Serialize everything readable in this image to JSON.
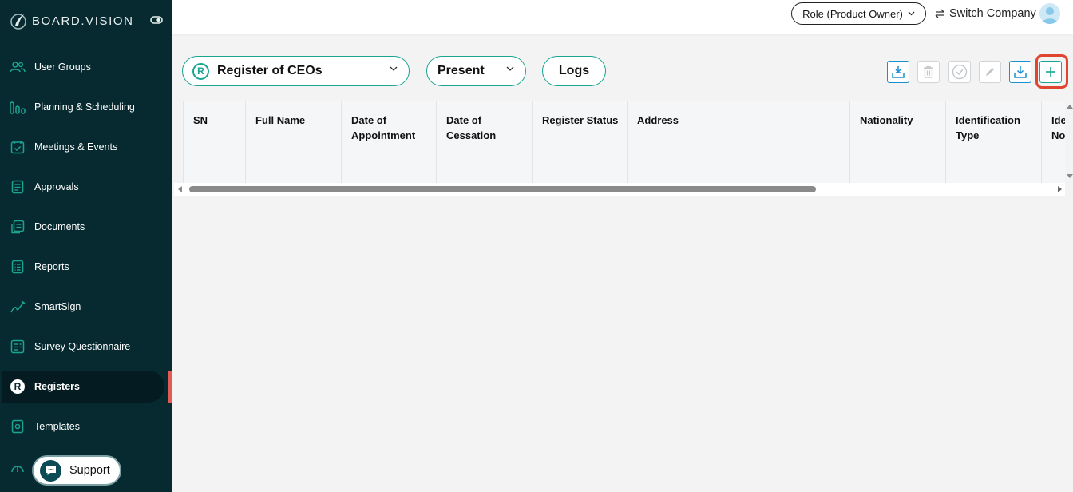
{
  "brand": {
    "name": "BOARD.VISION"
  },
  "sidebar": {
    "items": [
      {
        "label": "User Groups",
        "icon": "users-icon"
      },
      {
        "label": "Planning & Scheduling",
        "icon": "planning-icon"
      },
      {
        "label": "Meetings & Events",
        "icon": "calendar-icon"
      },
      {
        "label": "Approvals",
        "icon": "approvals-icon"
      },
      {
        "label": "Documents",
        "icon": "documents-icon"
      },
      {
        "label": "Reports",
        "icon": "reports-icon"
      },
      {
        "label": "SmartSign",
        "icon": "signature-icon"
      },
      {
        "label": "Survey Questionnaire",
        "icon": "survey-icon"
      },
      {
        "label": "Registers",
        "icon": "registers-icon",
        "active": true
      },
      {
        "label": "Templates",
        "icon": "templates-icon"
      }
    ],
    "support_label": "Support"
  },
  "header": {
    "role_label": "Role (Product Owner)",
    "switch_company_label": "Switch Company"
  },
  "filters": {
    "register_badge": "R",
    "register_selected": "Register of CEOs",
    "period_selected": "Present",
    "logs_label": "Logs"
  },
  "toolbar": {
    "buttons": [
      "import-icon",
      "delete-icon",
      "approve-icon",
      "edit-icon",
      "download-icon",
      "add-icon"
    ]
  },
  "table": {
    "columns": [
      {
        "line1": "SN",
        "line2": ""
      },
      {
        "line1": "Full Name",
        "line2": ""
      },
      {
        "line1": "Date of",
        "line2": "Appointment"
      },
      {
        "line1": "Date of",
        "line2": "Cessation"
      },
      {
        "line1": "Register Status",
        "line2": ""
      },
      {
        "line1": "Address",
        "line2": ""
      },
      {
        "line1": "Nationality",
        "line2": ""
      },
      {
        "line1": "Identification",
        "line2": "Type"
      },
      {
        "line1": "Ide",
        "line2": "No."
      }
    ],
    "rows": []
  },
  "colors": {
    "sidebar_bg": "#072a30",
    "accent": "#1aa592",
    "active_marker": "#e25b55",
    "highlight": "#e0452f"
  }
}
